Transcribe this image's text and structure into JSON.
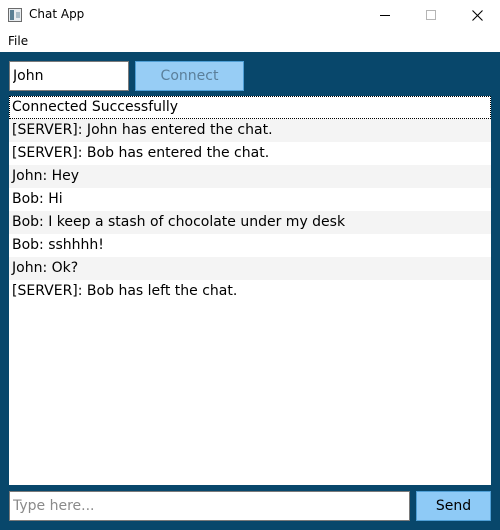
{
  "window": {
    "title": "Chat App",
    "icon": "chat-app-icon",
    "controls": [
      "minimize-icon",
      "maximize-icon",
      "close-icon"
    ]
  },
  "menu": {
    "file_label": "File"
  },
  "connect_bar": {
    "name_value": "John",
    "connect_label": "Connect",
    "connect_enabled": false
  },
  "chat": {
    "messages": [
      "Connected Successfully",
      "[SERVER]: John has entered the chat.",
      "[SERVER]: Bob has entered the chat.",
      "John: Hey",
      "Bob: Hi",
      "Bob: I keep a stash of chocolate under my desk",
      "Bob: sshhhh!",
      "John: Ok?",
      "[SERVER]: Bob has left the chat."
    ]
  },
  "compose": {
    "placeholder": "Type here...",
    "value": "",
    "send_label": "Send"
  },
  "colors": {
    "background": "#08476b",
    "button": "#97cdf5",
    "button_border": "#4f9fd6"
  }
}
